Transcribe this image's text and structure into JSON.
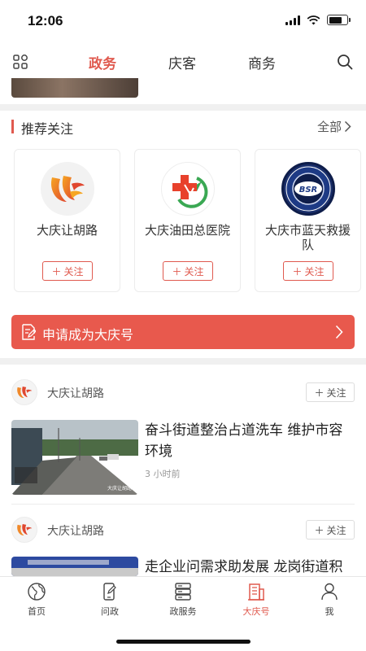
{
  "status": {
    "time": "12:06"
  },
  "nav": {
    "tabs": [
      {
        "label": "政务",
        "active": true
      },
      {
        "label": "庆客",
        "active": false
      },
      {
        "label": "商务",
        "active": false
      }
    ]
  },
  "recommend": {
    "title": "推荐关注",
    "all_label": "全部",
    "cards": [
      {
        "name": "大庆让胡路",
        "follow_label": "关注",
        "avatar": "rhl-logo"
      },
      {
        "name": "大庆油田总医院",
        "follow_label": "关注",
        "avatar": "hospital-cross-logo"
      },
      {
        "name": "大庆市蓝天救援队",
        "follow_label": "关注",
        "avatar": "bsr-logo",
        "badge_text": "BSR"
      }
    ]
  },
  "apply": {
    "label": "申请成为大庆号"
  },
  "feed": [
    {
      "author": "大庆让胡路",
      "follow_label": "关注",
      "title": "奋斗街道整治占道洗车 维护市容环境",
      "time": "3 小时前"
    },
    {
      "author": "大庆让胡路",
      "follow_label": "关注",
      "title": "走企业问需求助发展 龙岗街道积",
      "time": ""
    }
  ],
  "tabbar": {
    "items": [
      {
        "label": "首页",
        "icon": "globe-icon",
        "active": false
      },
      {
        "label": "问政",
        "icon": "phone-pen-icon",
        "active": false
      },
      {
        "label": "政服务",
        "icon": "server-icon",
        "active": false
      },
      {
        "label": "大庆号",
        "icon": "building-icon",
        "active": true
      },
      {
        "label": "我",
        "icon": "person-icon",
        "active": false
      }
    ]
  },
  "colors": {
    "accent": "#e05a4f",
    "apply_bg": "#e8594d",
    "divider": "#f0f0f0"
  }
}
